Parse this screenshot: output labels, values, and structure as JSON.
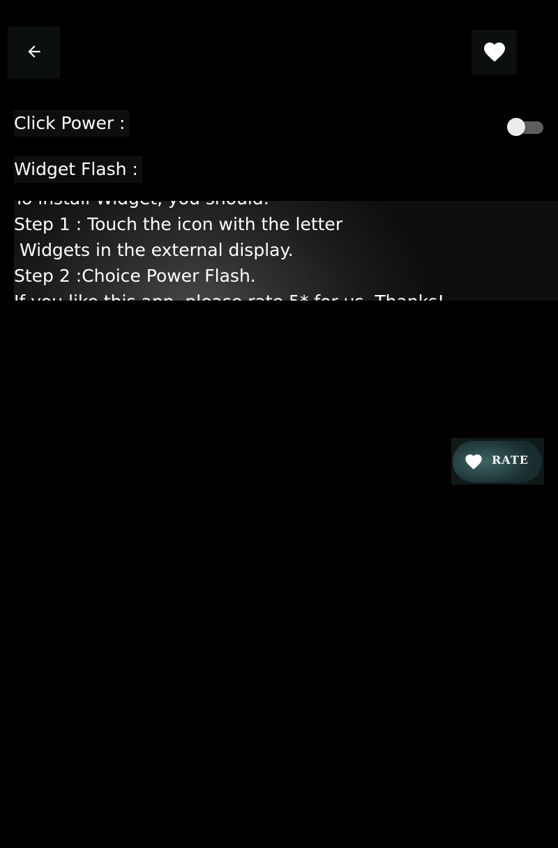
{
  "toolbar": {
    "back_icon": "arrow-left-icon",
    "favorite_icon": "heart-icon"
  },
  "settings": {
    "click_power_label": "Click Power :",
    "click_power_enabled": false,
    "widget_flash_label": "Widget Flash :"
  },
  "instructions": {
    "text": "To install Widget, you should:\nStep 1 : Touch the icon with the letter\n Widgets in the external display.\nStep 2 :Choice Power Flash.\nIf you like this app, please rate 5* for us. Thanks!"
  },
  "rate_button": {
    "label": "RATE",
    "icon": "heart-icon"
  }
}
